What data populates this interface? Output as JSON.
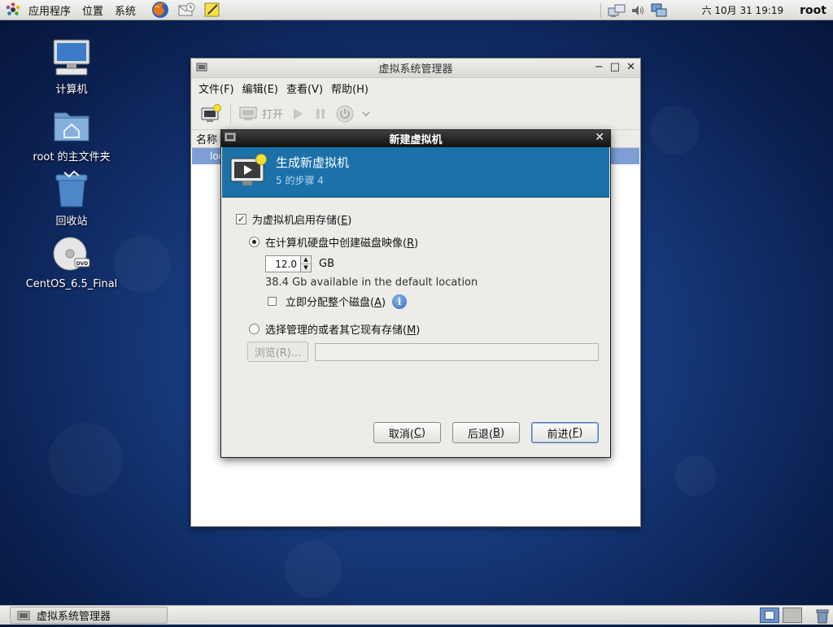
{
  "top_panel": {
    "menu": [
      "应用程序",
      "位置",
      "系统"
    ],
    "clock": "六 10月 31 19:19",
    "user": "root"
  },
  "desktop": {
    "icons": [
      {
        "label": "计算机",
        "icon": "computer-icon"
      },
      {
        "label": "root 的主文件夹",
        "icon": "home-folder-icon"
      },
      {
        "label": "回收站",
        "icon": "trash-icon"
      },
      {
        "label": "CentOS_6.5_Final",
        "icon": "dvd-icon"
      }
    ]
  },
  "main_window": {
    "title": "虚拟系统管理器",
    "menu": [
      "文件(F)",
      "编辑(E)",
      "查看(V)",
      "帮助(H)"
    ],
    "toolbar": {
      "open_label": "打开"
    },
    "column_name": "名称",
    "row_text": "loc"
  },
  "dialog": {
    "title": "新建虚拟机",
    "banner_title": "生成新虚拟机",
    "banner_subtitle": "5 的步骤 4",
    "enable_storage": {
      "text": "为虚拟机启用存储(",
      "key": "E",
      "end": ")",
      "checked": true
    },
    "create_image": {
      "text": "在计算机硬盘中创建磁盘映像(",
      "key": "R",
      "end": ")",
      "selected": true
    },
    "size_value": "12.0",
    "size_unit": "GB",
    "available_text": "38.4 Gb available in the default location",
    "allocate": {
      "text": "立即分配整个磁盘(",
      "key": "A",
      "end": ")",
      "checked": false
    },
    "managed_storage": {
      "text": "选择管理的或者其它现有存储(",
      "key": "M",
      "end": ")",
      "selected": false
    },
    "browse_label": "浏览(R)...",
    "buttons": {
      "cancel": {
        "text": "取消(",
        "key": "C",
        "end": ")"
      },
      "back": {
        "text": "后退(",
        "key": "B",
        "end": ")"
      },
      "forward": {
        "text": "前进(",
        "key": "F",
        "end": ")"
      }
    }
  },
  "bottom_panel": {
    "task_label": "虚拟系统管理器"
  },
  "colors": {
    "banner": "#1b71a8",
    "selection": "#7e9fd6",
    "desktop": "#173a7c"
  }
}
